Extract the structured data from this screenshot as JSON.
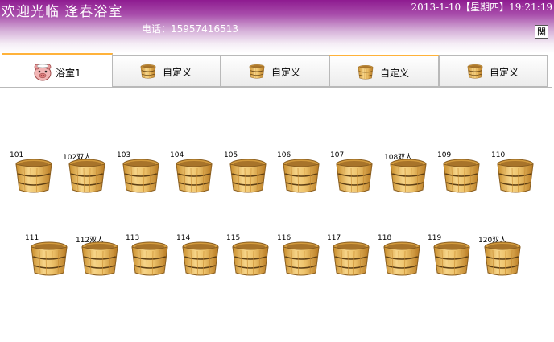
{
  "header": {
    "welcome": "欢迎光临  逢春浴室",
    "datetime": "2013-1-10【星期四】19:21:19",
    "phone": "电话：15957416513",
    "close_label": "関"
  },
  "tabs": [
    {
      "label": "浴室1",
      "icon": "piggy-icon",
      "active": true
    },
    {
      "label": "自定义",
      "icon": "bucket-icon",
      "active": false
    },
    {
      "label": "自定义",
      "icon": "bucket-icon",
      "active": false
    },
    {
      "label": "自定义",
      "icon": "bucket-icon",
      "active": false
    },
    {
      "label": "自定义",
      "icon": "bucket-icon",
      "active": false
    }
  ],
  "rooms": [
    {
      "label": "101"
    },
    {
      "label": "102双人"
    },
    {
      "label": "103"
    },
    {
      "label": "104"
    },
    {
      "label": "105"
    },
    {
      "label": "106"
    },
    {
      "label": "107"
    },
    {
      "label": "108双人"
    },
    {
      "label": "109"
    },
    {
      "label": "110"
    },
    {
      "label": "111"
    },
    {
      "label": "112双人"
    },
    {
      "label": "113"
    },
    {
      "label": "114"
    },
    {
      "label": "115"
    },
    {
      "label": "116"
    },
    {
      "label": "117"
    },
    {
      "label": "118"
    },
    {
      "label": "119"
    },
    {
      "label": "120双人"
    }
  ],
  "colors": {
    "header_top": "#8e1b90",
    "tab_accent": "#ffb23a",
    "bucket_wood": "#e9b95a",
    "bucket_band": "#6b4a1c"
  }
}
